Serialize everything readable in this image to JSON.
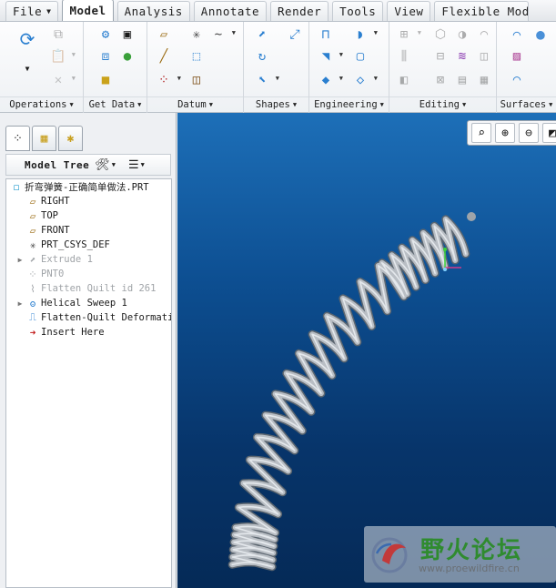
{
  "menu": {
    "tabs": [
      {
        "label": "File",
        "has_caret": true
      },
      {
        "label": "Model",
        "active": true
      },
      {
        "label": "Analysis"
      },
      {
        "label": "Annotate"
      },
      {
        "label": "Render"
      },
      {
        "label": "Tools"
      },
      {
        "label": "View"
      },
      {
        "label": "Flexible Mode"
      }
    ]
  },
  "ribbon": {
    "groups": [
      {
        "label": "Operations"
      },
      {
        "label": "Get Data"
      },
      {
        "label": "Datum"
      },
      {
        "label": "Shapes"
      },
      {
        "label": "Engineering"
      },
      {
        "label": "Editing"
      },
      {
        "label": "Surfaces"
      }
    ]
  },
  "model_tree": {
    "title": "Model Tree",
    "items": [
      {
        "label": "折弯弹簧-正确简单做法.PRT",
        "icon": "part-icon",
        "dim": false
      },
      {
        "label": "RIGHT",
        "icon": "datum-plane-icon",
        "dim": false
      },
      {
        "label": "TOP",
        "icon": "datum-plane-icon",
        "dim": false
      },
      {
        "label": "FRONT",
        "icon": "datum-plane-icon",
        "dim": false
      },
      {
        "label": "PRT_CSYS_DEF",
        "icon": "csys-icon",
        "dim": false
      },
      {
        "label": "Extrude 1",
        "icon": "extrude-icon",
        "dim": true
      },
      {
        "label": "PNT0",
        "icon": "datum-point-icon",
        "dim": true
      },
      {
        "label": "Flatten Quilt id 261",
        "icon": "flatten-quilt-icon",
        "dim": true
      },
      {
        "label": "Helical Sweep 1",
        "icon": "helical-sweep-icon",
        "dim": false
      },
      {
        "label": "Flatten-Quilt Deformation",
        "icon": "flatten-deform-icon",
        "dim": false
      },
      {
        "label": "Insert Here",
        "icon": "insert-here-icon",
        "dim": false
      }
    ]
  },
  "watermark": {
    "chinese": "野火论坛",
    "url": "www.proewildfire.cn"
  },
  "colors": {
    "viewport_top": "#1d6fb8",
    "viewport_bottom": "#052a57",
    "spring": "#b9bec4",
    "watermark_green": "#2f8b2f"
  }
}
